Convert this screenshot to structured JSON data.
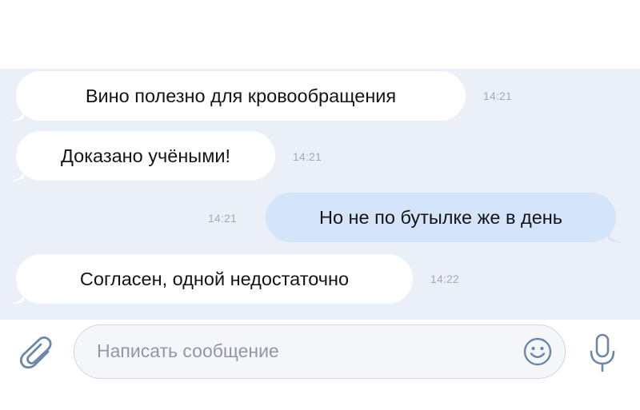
{
  "messages": [
    {
      "text": "Вино полезно для кровообращения",
      "time": "14:21",
      "direction": "incoming"
    },
    {
      "text": "Доказано учёными!",
      "time": "14:21",
      "direction": "incoming"
    },
    {
      "text": "Но не по бутылке же в день",
      "time": "14:21",
      "direction": "outgoing"
    },
    {
      "text": "Согласен, одной недостаточно",
      "time": "14:22",
      "direction": "incoming"
    }
  ],
  "composer": {
    "placeholder": "Написать сообщение",
    "attach_icon": "paperclip-icon",
    "emoji_icon": "smiley-icon",
    "voice_icon": "microphone-icon"
  },
  "colors": {
    "chat_background": "#ebeff8",
    "incoming_bubble": "#ffffff",
    "outgoing_bubble": "#d4e4fa",
    "timestamp": "#a3abb8",
    "icon": "#6e86a8"
  }
}
